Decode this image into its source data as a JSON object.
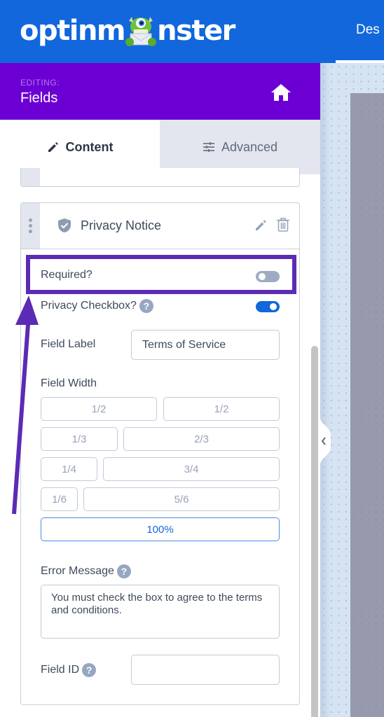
{
  "app": {
    "logo_text_left": "optinm",
    "logo_text_right": "nster",
    "top_nav_partial": "Des"
  },
  "editing_header": {
    "label": "EDITING:",
    "title": "Fields",
    "home_icon": "home-icon"
  },
  "tabs": [
    {
      "label": "Content",
      "icon": "pencil-icon",
      "active": true
    },
    {
      "label": "Advanced",
      "icon": "sliders-icon",
      "active": false
    }
  ],
  "field_card": {
    "title": "Privacy Notice",
    "icon": "shield-check-icon",
    "required": {
      "label": "Required?",
      "enabled": false
    },
    "privacy_checkbox": {
      "label": "Privacy Checkbox?",
      "enabled": true,
      "help": "?"
    },
    "field_label": {
      "label": "Field Label",
      "value": "Terms of Service"
    },
    "field_width": {
      "label": "Field Width",
      "options": [
        "1/2",
        "1/2",
        "1/3",
        "2/3",
        "1/4",
        "3/4",
        "1/6",
        "5/6",
        "100%"
      ],
      "selected": "100%"
    },
    "error_message": {
      "label": "Error Message",
      "help": "?",
      "value": "You must check the box to agree to the terms and conditions."
    },
    "field_id": {
      "label": "Field ID",
      "help": "?",
      "value": ""
    }
  },
  "colors": {
    "topbar": "#1167db",
    "editing_header": "#6c00d4",
    "annotation": "#5b2bb5",
    "toggle_on": "#1167db",
    "toggle_off": "#9eabc4"
  }
}
